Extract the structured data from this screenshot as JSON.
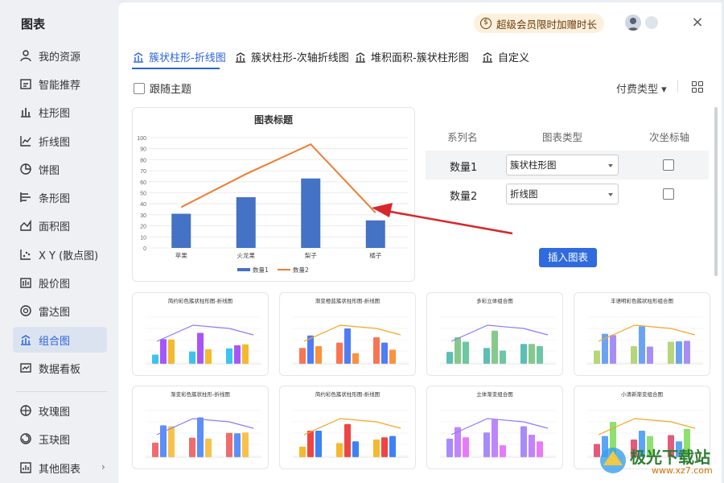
{
  "sidebar": {
    "title": "图表",
    "items": [
      {
        "label": "我的资源",
        "icon": "user-icon"
      },
      {
        "label": "智能推荐",
        "icon": "recommend-icon"
      },
      {
        "label": "柱形图",
        "icon": "column-chart-icon"
      },
      {
        "label": "折线图",
        "icon": "line-chart-icon"
      },
      {
        "label": "饼图",
        "icon": "pie-chart-icon"
      },
      {
        "label": "条形图",
        "icon": "bar-chart-icon"
      },
      {
        "label": "面积图",
        "icon": "area-chart-icon"
      },
      {
        "label": "X Y (散点图)",
        "icon": "scatter-chart-icon"
      },
      {
        "label": "股价图",
        "icon": "stock-chart-icon"
      },
      {
        "label": "雷达图",
        "icon": "radar-chart-icon"
      },
      {
        "label": "组合图",
        "icon": "combo-chart-icon",
        "active": true
      },
      {
        "label": "数据看板",
        "icon": "dashboard-icon"
      },
      {
        "label": "玫瑰图",
        "icon": "rose-chart-icon"
      },
      {
        "label": "玉玦图",
        "icon": "ring-chart-icon"
      },
      {
        "label": "其他图表",
        "icon": "other-chart-icon"
      }
    ]
  },
  "header": {
    "vip_label": "超级会员限时加赠时长",
    "close_label": "×"
  },
  "tabs": [
    {
      "label": "簇状柱形-折线图",
      "active": true
    },
    {
      "label": "簇状柱形-次轴折线图"
    },
    {
      "label": "堆积面积-簇状柱形图"
    },
    {
      "label": "自定义"
    }
  ],
  "options": {
    "follow_theme": "跟随主题",
    "pay_type": "付费类型 ▾"
  },
  "preview": {
    "title": "图表标题",
    "chart_data": {
      "type": "bar",
      "categories": [
        "苹果",
        "火龙果",
        "梨子",
        "橘子"
      ],
      "series": [
        {
          "name": "数量1",
          "type": "bar",
          "values": [
            31,
            46,
            63,
            25
          ]
        },
        {
          "name": "数量2",
          "type": "line",
          "values": [
            37,
            67,
            94,
            32
          ]
        }
      ],
      "ylim": [
        0,
        100
      ],
      "yticks": [
        0,
        10,
        20,
        30,
        40,
        50,
        60,
        70,
        80,
        90,
        100
      ],
      "grid": true,
      "legend": "bottom"
    }
  },
  "config": {
    "headers": [
      "系列名",
      "图表类型",
      "次坐标轴"
    ],
    "rows": [
      {
        "name": "数量1",
        "type": "簇状柱形图",
        "secondary": false
      },
      {
        "name": "数量2",
        "type": "折线图",
        "secondary": false
      }
    ],
    "insert_label": "插入图表"
  },
  "templates": [
    {
      "title": "简约彩色簇状柱形图-折线图"
    },
    {
      "title": "渐变橙蓝簇状柱形图-折线图"
    },
    {
      "title": "多彩立体组合图"
    },
    {
      "title": "丰语明彩色簇状柱形组合图"
    },
    {
      "title": "渐变彩色簇状柱形-折线图"
    },
    {
      "title": "简约彩色簇状柱形图-折线图"
    },
    {
      "title": "立体渐变组合图"
    },
    {
      "title": "小清新渐变组合图"
    }
  ],
  "watermark": {
    "text": "极光下载站",
    "url": "www.xz7.com"
  },
  "colors": {
    "accent": "#2b63d9",
    "bar": "#4472c4",
    "line": "#ed7d31",
    "arrow": "#d9262c"
  }
}
